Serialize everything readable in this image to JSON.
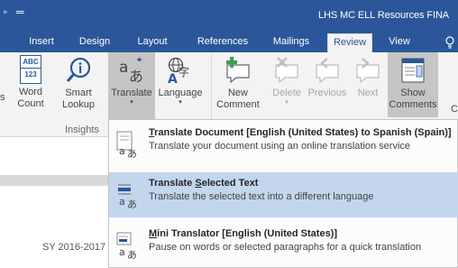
{
  "titlebar": {
    "qat_arrow": "▸",
    "qat_customize": "═",
    "document_title": "LHS MC ELL Resources FINA"
  },
  "tabs": [
    {
      "label": "Insert"
    },
    {
      "label": "Design"
    },
    {
      "label": "Layout"
    },
    {
      "label": "References"
    },
    {
      "label": "Mailings"
    },
    {
      "label": "Review",
      "active": true
    },
    {
      "label": "View"
    }
  ],
  "tell_me_icon": "lightbulb-icon",
  "ribbon": {
    "word_count": {
      "label1": "Word",
      "label2": "Count",
      "icon_text1": "ABC",
      "icon_text2": "123"
    },
    "smart_lookup": {
      "label1": "Smart",
      "label2": "Lookup"
    },
    "translate": {
      "label": "Translate",
      "caret": "▾"
    },
    "language": {
      "label": "Language",
      "caret": "▾"
    },
    "new_comment": {
      "label1": "New",
      "label2": "Comment"
    },
    "delete": {
      "label": "Delete",
      "caret": "▾"
    },
    "previous": {
      "label": "Previous"
    },
    "next": {
      "label": "Next"
    },
    "show_comments": {
      "label1": "Show",
      "label2": "Comments"
    },
    "insights_group": "Insights",
    "partial_left": "s",
    "partial_right": "C"
  },
  "document": {
    "footer_text": "SY 2016-2017"
  },
  "translate_menu": {
    "items": [
      {
        "title_pre": "",
        "title_u": "T",
        "title_post": "ranslate Document [English (United States) to Spanish (Spain)]",
        "description": "Translate your document using an online translation service"
      },
      {
        "title_pre": "Translate ",
        "title_u": "S",
        "title_post": "elected Text",
        "description": "Translate the selected text into a different language"
      },
      {
        "title_pre": "",
        "title_u": "M",
        "title_post": "ini Translator [English (United States)]",
        "description": "Pause on words or selected paragraphs for a quick translation"
      }
    ]
  },
  "colors": {
    "titlebar": "#2b579a",
    "ribbon": "#f3f3f3",
    "menu_hover": "#c4d5ee",
    "accent_green": "#3f9e57"
  }
}
